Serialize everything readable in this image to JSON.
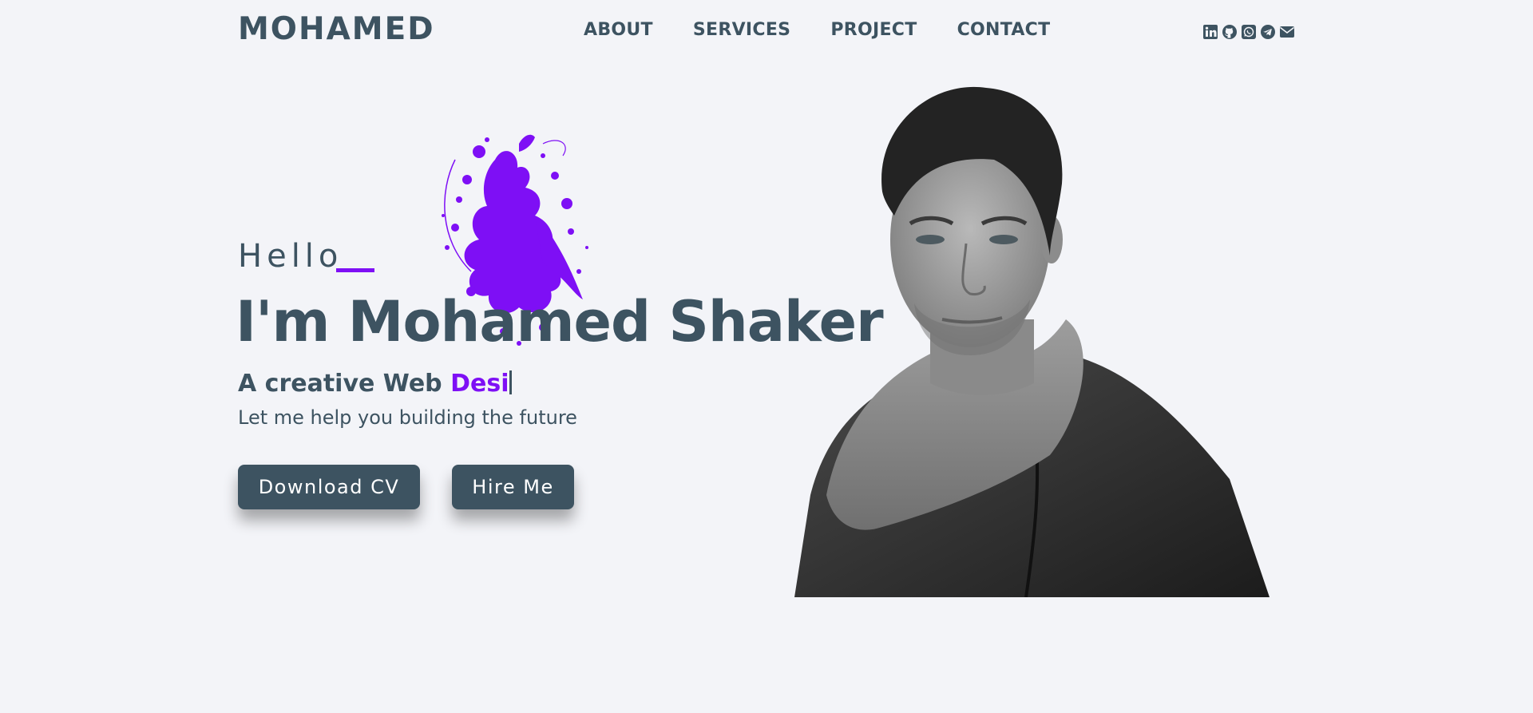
{
  "header": {
    "logo": "MOHAMED",
    "menu": [
      {
        "label": "ABOUT"
      },
      {
        "label": "SERVICES"
      },
      {
        "label": "PROJECT"
      },
      {
        "label": "CONTACT"
      }
    ],
    "social_icons": [
      "linkedin-icon",
      "github-icon",
      "whatsapp-icon",
      "telegram-icon",
      "email-icon"
    ]
  },
  "hero": {
    "greeting": "Hello",
    "name": "I'm Mohamed Shaker",
    "tagline_prefix": "A creative Web ",
    "tagline_typed": "Desi",
    "subtitle": "Let me help you building the future",
    "buttons": {
      "download_cv": "Download CV",
      "hire_me": "Hire Me"
    }
  },
  "colors": {
    "background": "#f3f4f8",
    "text": "#3d5361",
    "accent": "#7e0ff5",
    "button": "#3d5361"
  }
}
